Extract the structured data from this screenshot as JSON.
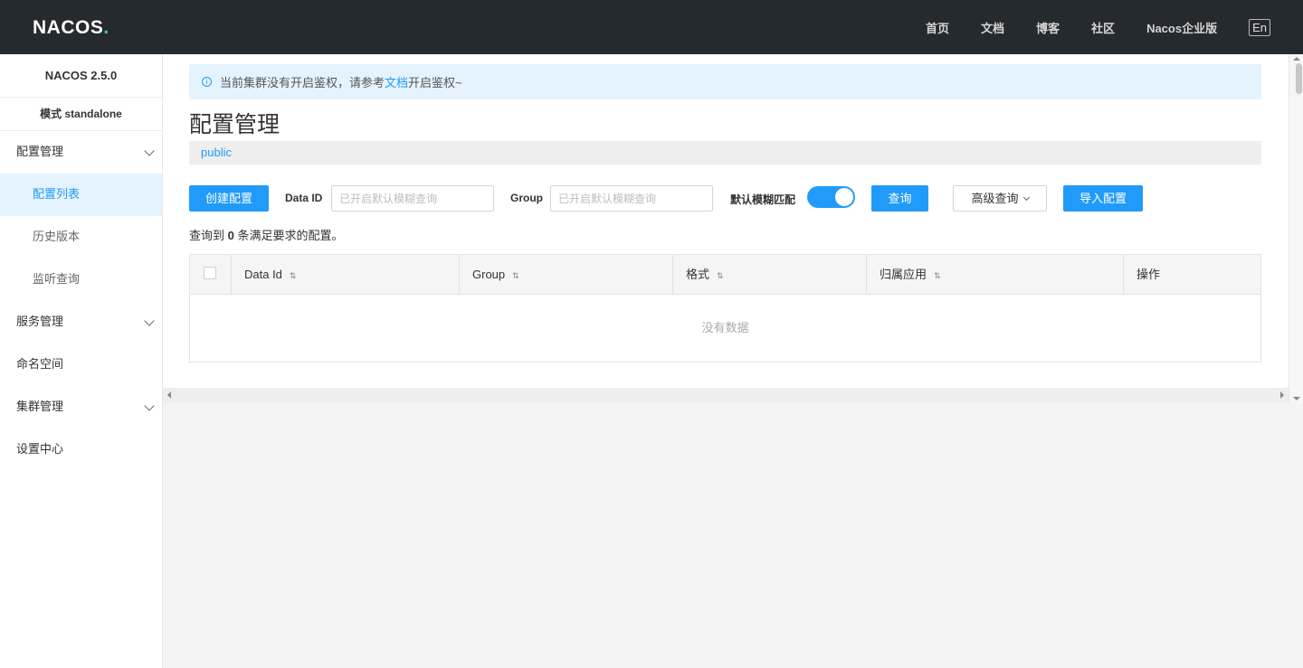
{
  "topbar": {
    "logo_prefix": "NAC",
    "logo_o": "O",
    "logo_suffix": "S",
    "logo_dot": ".",
    "nav": [
      "首页",
      "文档",
      "博客",
      "社区",
      "Nacos企业版"
    ],
    "lang": "En"
  },
  "sidebar": {
    "version": "NACOS 2.5.0",
    "mode": "模式 standalone",
    "items": [
      {
        "label": "配置管理",
        "expandable": true
      },
      {
        "label": "配置列表",
        "sub": true,
        "active": true
      },
      {
        "label": "历史版本",
        "sub": true
      },
      {
        "label": "监听查询",
        "sub": true
      },
      {
        "label": "服务管理",
        "expandable": true
      },
      {
        "label": "命名空间"
      },
      {
        "label": "集群管理",
        "expandable": true
      },
      {
        "label": "设置中心"
      }
    ]
  },
  "notice": {
    "icon": "i",
    "before": "当前集群没有开启鉴权，请参考",
    "link": "文档",
    "after": "开启鉴权~"
  },
  "page_title": "配置管理",
  "namespace": "public",
  "toolbar": {
    "create_label": "创建配置",
    "data_id_label": "Data ID",
    "data_id_placeholder": "已开启默认模糊查询",
    "group_label": "Group",
    "group_placeholder": "已开启默认模糊查询",
    "fuzzy_label": "默认模糊匹配",
    "fuzzy_enabled": true,
    "query_label": "查询",
    "advanced_label": "高级查询",
    "import_label": "导入配置"
  },
  "result": {
    "prefix": "查询到",
    "count": "0",
    "suffix": "条满足要求的配置。"
  },
  "table": {
    "columns": [
      "Data Id",
      "Group",
      "格式",
      "归属应用",
      "操作"
    ],
    "sort_icon": "⇅",
    "empty_text": "没有数据"
  },
  "colors": {
    "accent": "#209bfa",
    "topbar": "#252a2f"
  }
}
